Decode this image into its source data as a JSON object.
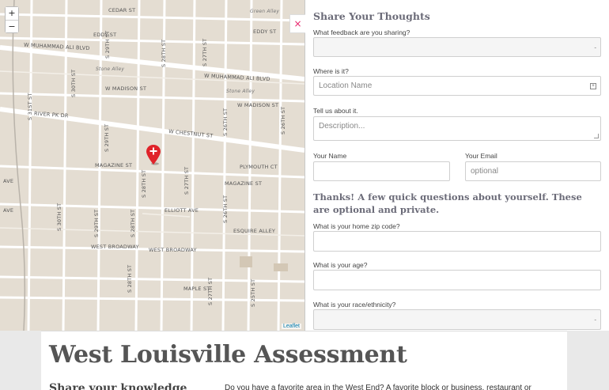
{
  "map": {
    "zoom_in": "+",
    "zoom_out": "−",
    "attribution": "Leaflet",
    "streets": {
      "cedar": "CEDAR ST",
      "green_alley": "Green Alley",
      "eddy_1": "EDDY ST",
      "eddy_2": "EDDY ST",
      "ali_1": "W MUHAMMAD ALI BLVD",
      "ali_2": "W MUHAMMAD ALI BLVD",
      "stone_alley_1": "Stone Alley",
      "stone_alley_2": "Stone Alley",
      "madison_1": "W MADISON ST",
      "madison_2": "W MADISON ST",
      "river": "RIVER PK DR",
      "chestnut": "W CHESTNUT ST",
      "magazine_1": "MAGAZINE ST",
      "magazine_2": "MAGAZINE ST",
      "plymouth": "PLYMOUTH CT",
      "elliott": "ELLIOTT AVE",
      "esquire": "ESQUIRE ALLEY",
      "wb_1": "WEST BROADWAY",
      "wb_2": "WEST BROADWAY",
      "maple": "MAPLE ST",
      "ave_1": "AVE",
      "ave_2": "AVE",
      "s31": "S 31ST ST",
      "s30_1": "S 30TH ST",
      "s30_2": "S 30TH ST",
      "s29_1": "S 29TH ST",
      "s29_2": "S 29TH ST",
      "s29_3": "S 29TH ST",
      "s28_1": "S 28TH ST",
      "s28_2": "S 28TH ST",
      "s28_3": "S 28TH ST",
      "s28_4": "S 28TH ST",
      "s27_1": "S 27TH ST",
      "s27_2": "S 27TH ST",
      "s27_3": "S 27TH ST",
      "s26_1": "S 26TH ST",
      "s26_2": "S 26TH ST",
      "s26_3": "S 26TH ST",
      "s25": "S 25TH ST"
    }
  },
  "panel": {
    "close": "×",
    "title": "Share Your Thoughts",
    "feedback_label": "What feedback are you sharing?",
    "feedback_value": "",
    "where_label": "Where is it?",
    "location_placeholder": "Location Name",
    "tell_label": "Tell us about it.",
    "description_placeholder": "Description...",
    "name_label": "Your Name",
    "name_value": "",
    "email_label": "Your Email",
    "email_placeholder": "optional",
    "questions_heading": "Thanks! A few quick questions about yourself. These are optional and private.",
    "zip_label": "What is your home zip code?",
    "zip_value": "",
    "age_label": "What is your age?",
    "age_value": "",
    "race_label": "What is your race/ethnicity?",
    "race_value": ""
  },
  "content": {
    "title": "West Louisville Assessment",
    "subheading": "Share your knowledge",
    "intro": "Do you have a favorite area in the West End? A favorite block or business, restaurant or"
  }
}
